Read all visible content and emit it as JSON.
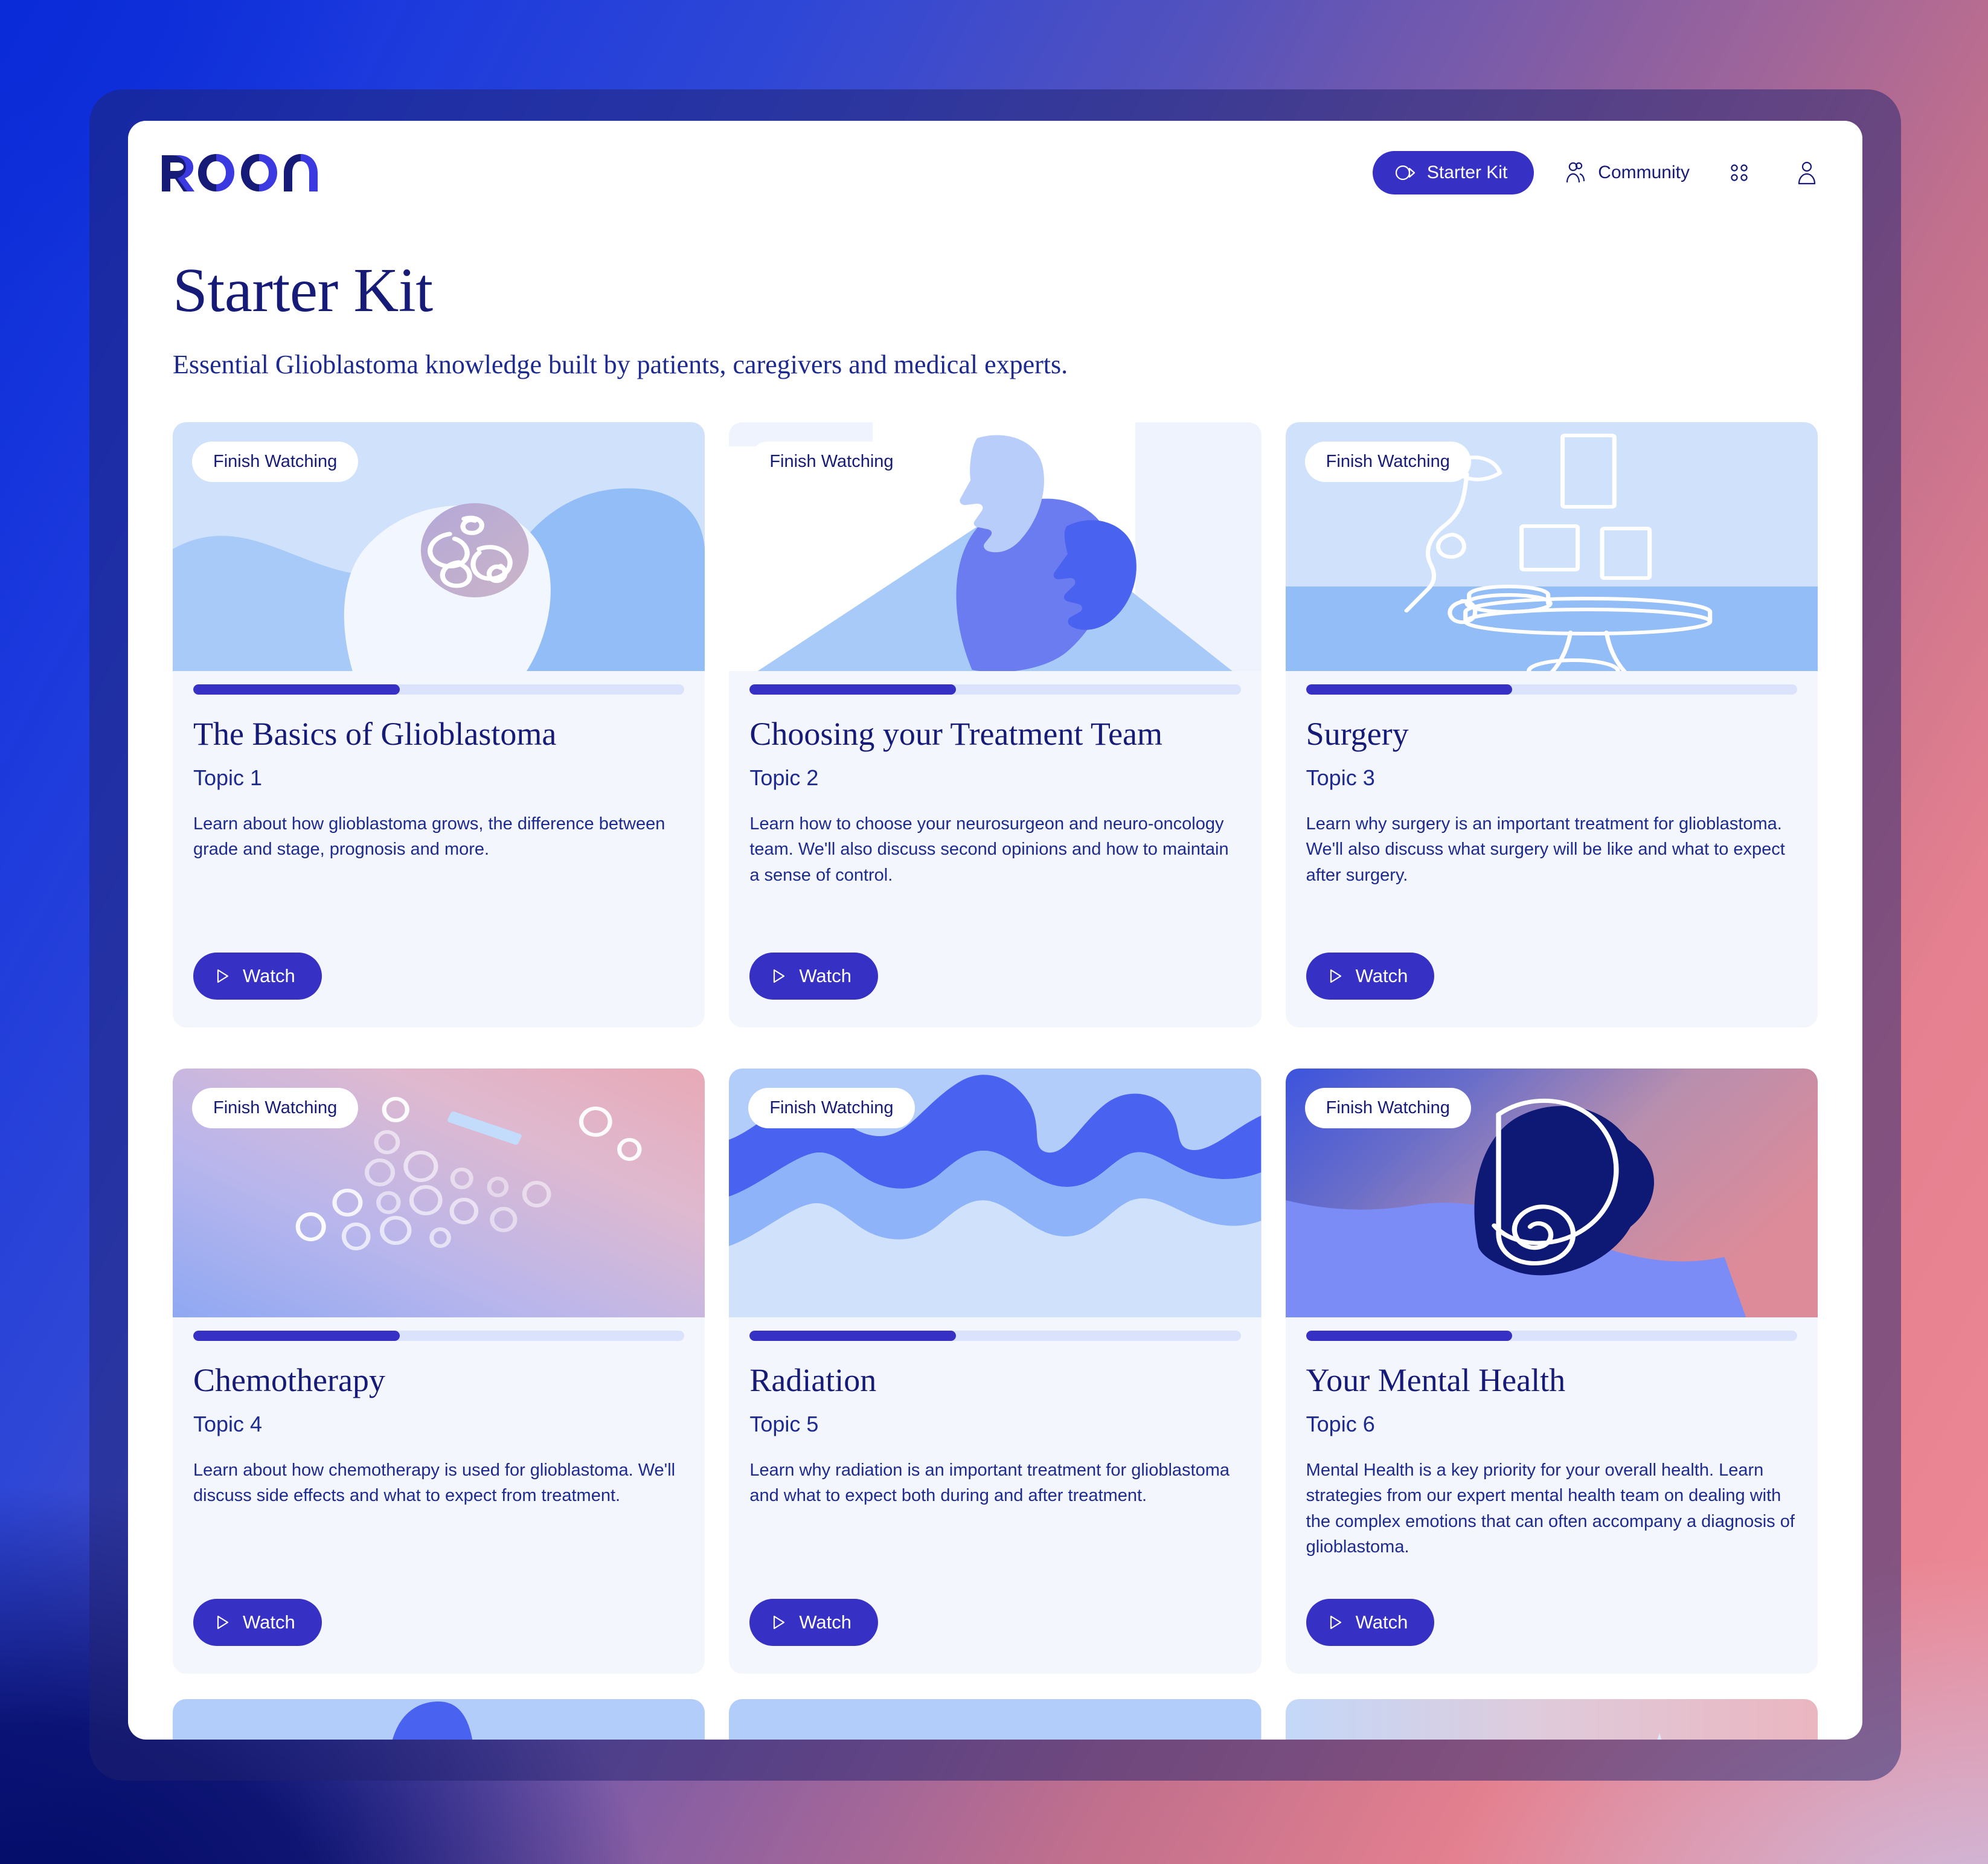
{
  "brand": {
    "name": "ROON",
    "logo_colors": {
      "dark": "#161b78",
      "light": "#3b3ae0"
    }
  },
  "header": {
    "starter_kit_button": {
      "label": "Starter Kit",
      "icon": "video-camera-icon"
    },
    "community_link": {
      "label": "Community",
      "icon": "people-icon"
    },
    "apps_button": {
      "icon": "grid-dots-icon"
    },
    "profile_button": {
      "icon": "user-avatar-icon"
    },
    "accent_color": "#3730c4"
  },
  "page": {
    "title": "Starter Kit",
    "subtitle": "Essential Glioblastoma knowledge built by patients, caregivers and medical experts.",
    "title_color": "#161b78"
  },
  "labels": {
    "finish_watching": "Finish Watching",
    "watch": "Watch"
  },
  "cards": [
    {
      "title": "The Basics of Glioblastoma",
      "topic": "Topic 1",
      "description": "Learn about how glioblastoma grows, the difference between grade and stage, prognosis and more.",
      "badge": "Finish Watching",
      "watch_label": "Watch",
      "progress_percent": 42,
      "thumb": "head-with-brain-illustration"
    },
    {
      "title": "Choosing your Treatment Team",
      "topic": "Topic 2",
      "description": "Learn how to choose your neurosurgeon and neuro-oncology team. We'll also discuss second opinions and how to maintain a sense of control.",
      "badge": "Finish Watching",
      "watch_label": "Watch",
      "progress_percent": 42,
      "thumb": "three-heads-illustration"
    },
    {
      "title": "Surgery",
      "topic": "Topic 3",
      "description": "Learn why surgery is an important treatment for glioblastoma. We'll also discuss what surgery will be like and what to expect after surgery.",
      "badge": "Finish Watching",
      "watch_label": "Watch",
      "progress_percent": 42,
      "thumb": "operating-room-illustration"
    },
    {
      "title": "Chemotherapy",
      "topic": "Topic 4",
      "description": "Learn about how chemotherapy is used for glioblastoma. We'll discuss side effects and what to expect from treatment.",
      "badge": "Finish Watching",
      "watch_label": "Watch",
      "progress_percent": 42,
      "thumb": "bubbles-gradient-illustration"
    },
    {
      "title": "Radiation",
      "topic": "Topic 5",
      "description": "Learn why radiation is an important treatment for glioblastoma and what to expect both during and after treatment.",
      "badge": "Finish Watching",
      "watch_label": "Watch",
      "progress_percent": 42,
      "thumb": "blue-waves-illustration"
    },
    {
      "title": "Your Mental Health",
      "topic": "Topic 6",
      "description": "Mental Health is a key priority for your overall health. Learn strategies from our expert mental health team on dealing with the complex emotions that can often accompany a diagnosis of glioblastoma.",
      "badge": "Finish Watching",
      "watch_label": "Watch",
      "progress_percent": 42,
      "thumb": "spiral-head-illustration"
    }
  ],
  "colors": {
    "accent": "#3730c4",
    "navy": "#161b78",
    "card_bg": "#f4f6fe",
    "progress_track": "#dbe2fb",
    "thumb_light_blue": "#cfe1fb",
    "thumb_mid_blue": "#93bdf7",
    "thumb_periwinkle": "#6b7cf0",
    "thumb_bright_blue": "#4a62f0",
    "thumb_dark_navy": "#0e1875",
    "thumb_pink": "#e8a9b6"
  }
}
